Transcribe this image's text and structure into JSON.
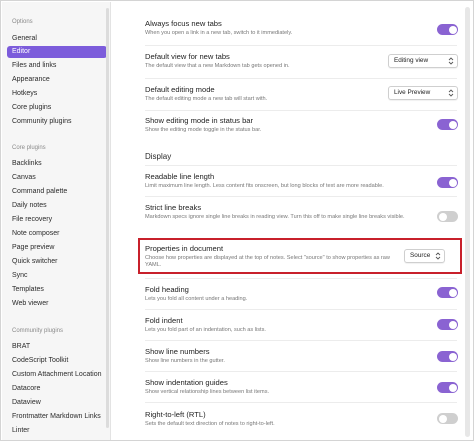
{
  "sidebar": {
    "groups": [
      {
        "heading": "Options",
        "items": [
          {
            "label": "General",
            "active": false
          },
          {
            "label": "Editor",
            "active": true
          },
          {
            "label": "Files and links",
            "active": false
          },
          {
            "label": "Appearance",
            "active": false
          },
          {
            "label": "Hotkeys",
            "active": false
          },
          {
            "label": "Core plugins",
            "active": false
          },
          {
            "label": "Community plugins",
            "active": false
          }
        ]
      },
      {
        "heading": "Core plugins",
        "items": [
          {
            "label": "Backlinks",
            "active": false
          },
          {
            "label": "Canvas",
            "active": false
          },
          {
            "label": "Command palette",
            "active": false
          },
          {
            "label": "Daily notes",
            "active": false
          },
          {
            "label": "File recovery",
            "active": false
          },
          {
            "label": "Note composer",
            "active": false
          },
          {
            "label": "Page preview",
            "active": false
          },
          {
            "label": "Quick switcher",
            "active": false
          },
          {
            "label": "Sync",
            "active": false
          },
          {
            "label": "Templates",
            "active": false
          },
          {
            "label": "Web viewer",
            "active": false
          }
        ]
      },
      {
        "heading": "Community plugins",
        "items": [
          {
            "label": "BRAT",
            "active": false
          },
          {
            "label": "CodeScript Toolkit",
            "active": false
          },
          {
            "label": "Custom Attachment Location",
            "active": false
          },
          {
            "label": "Datacore",
            "active": false
          },
          {
            "label": "Dataview",
            "active": false
          },
          {
            "label": "Frontmatter Markdown Links",
            "active": false
          },
          {
            "label": "Linter",
            "active": false
          }
        ]
      }
    ]
  },
  "settings_top": [
    {
      "name": "Always focus new tabs",
      "desc": "When you open a link in a new tab, switch to it immediately.",
      "control": "toggle",
      "on": true
    },
    {
      "name": "Default view for new tabs",
      "desc": "The default view that a new Markdown tab gets opened in.",
      "control": "select",
      "value": "Editing view"
    },
    {
      "name": "Default editing mode",
      "desc": "The default editing mode a new tab will start with.",
      "control": "select",
      "value": "Live Preview"
    },
    {
      "name": "Show editing mode in status bar",
      "desc": "Show the editing mode toggle in the status bar.",
      "control": "toggle",
      "on": true
    }
  ],
  "display_section": {
    "title": "Display",
    "settings": [
      {
        "name": "Readable line length",
        "desc": "Limit maximum line length. Less content fits onscreen, but long blocks of text are more readable.",
        "control": "toggle",
        "on": true
      },
      {
        "name": "Strict line breaks",
        "desc": "Markdown specs ignore single line breaks in reading view. Turn this off to make single line breaks visible.",
        "control": "toggle",
        "on": false
      },
      {
        "name": "Properties in document",
        "desc": "Choose how properties are displayed at the top of notes. Select \"source\" to show properties as raw YAML.",
        "control": "select",
        "value": "Source",
        "highlighted": true
      },
      {
        "name": "Fold heading",
        "desc": "Lets you fold all content under a heading.",
        "control": "toggle",
        "on": true
      },
      {
        "name": "Fold indent",
        "desc": "Lets you fold part of an indentation, such as lists.",
        "control": "toggle",
        "on": true
      },
      {
        "name": "Show line numbers",
        "desc": "Show line numbers in the gutter.",
        "control": "toggle",
        "on": true
      },
      {
        "name": "Show indentation guides",
        "desc": "Show vertical relationship lines between list items.",
        "control": "toggle",
        "on": true
      },
      {
        "name": "Right-to-left (RTL)",
        "desc": "Sets the default text direction of notes to right-to-left.",
        "control": "toggle",
        "on": false
      }
    ]
  },
  "colors": {
    "accent": "#7c5cdb",
    "toggle_on": "#8a63d2",
    "toggle_off": "#cfcfcf",
    "highlight": "#c8202b"
  },
  "icons": {
    "select_chevron": "chevron-up-down-icon"
  }
}
